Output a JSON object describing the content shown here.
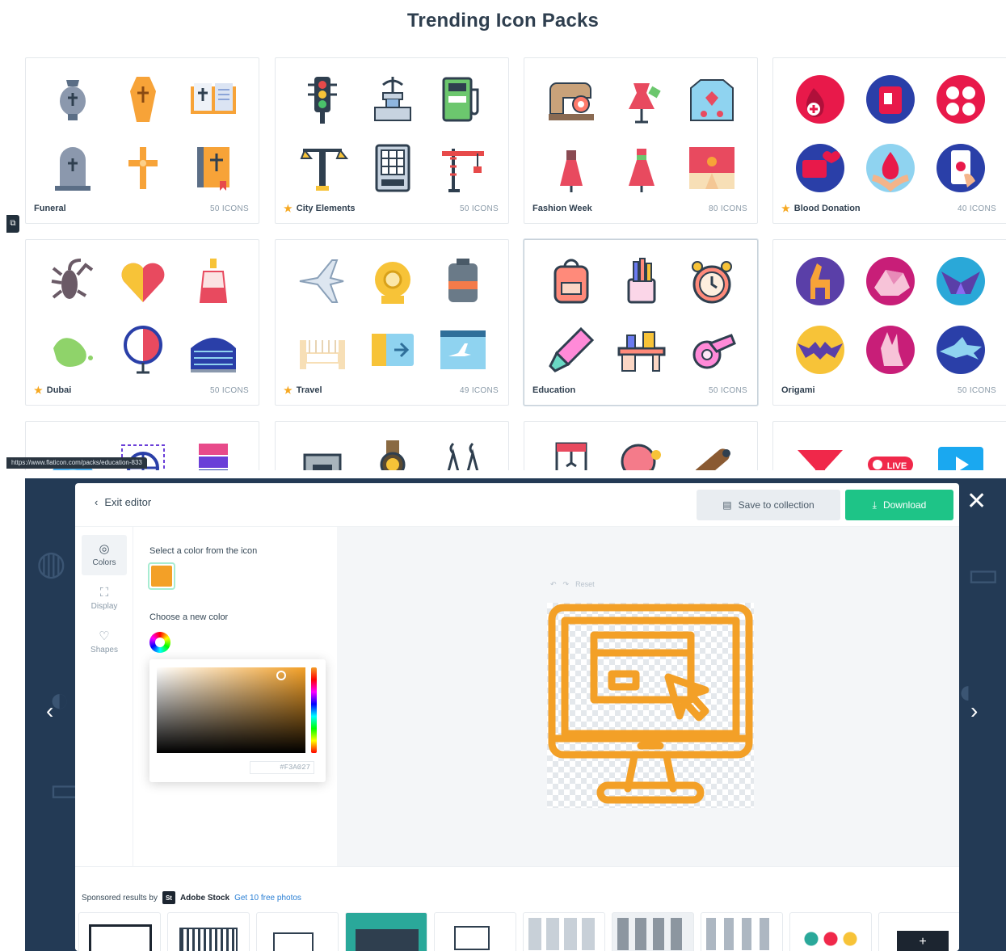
{
  "top": {
    "title": "Trending Icon Packs",
    "packs": [
      {
        "name": "Funeral",
        "count": "50 ICONS",
        "premium": false
      },
      {
        "name": "City Elements",
        "count": "50 ICONS",
        "premium": true
      },
      {
        "name": "Fashion Week",
        "count": "80 ICONS",
        "premium": false
      },
      {
        "name": "Blood Donation",
        "count": "40 ICONS",
        "premium": true
      },
      {
        "name": "Dubai",
        "count": "50 ICONS",
        "premium": true
      },
      {
        "name": "Travel",
        "count": "49 ICONS",
        "premium": true
      },
      {
        "name": "Education",
        "count": "50 ICONS",
        "premium": false
      },
      {
        "name": "Origami",
        "count": "50 ICONS",
        "premium": false
      }
    ],
    "status_url": "https://www.flaticon.com/packs/education-833",
    "premium_icon": "star-icon"
  },
  "editor": {
    "exit_label": "Exit editor",
    "save_label": "Save to collection",
    "download_label": "Download",
    "tools": [
      {
        "label": "Colors",
        "icon": "palette-icon"
      },
      {
        "label": "Display",
        "icon": "expand-icon"
      },
      {
        "label": "Shapes",
        "icon": "shapes-icon"
      }
    ],
    "select_color_label": "Select a color from the icon",
    "choose_color_label": "Choose a new color",
    "current_color": "#F3A027",
    "hex_value": "#F3A027",
    "undo_label": "Reset",
    "icon_color": "#F3A027"
  },
  "sponsor": {
    "prefix": "Sponsored results by",
    "brand_badge": "St",
    "brand": "Adobe Stock",
    "cta": "Get 10 free photos"
  },
  "colors": {
    "accent_green": "#1EC487",
    "brand_orange": "#F3A027",
    "navy_bg": "#233A55"
  }
}
